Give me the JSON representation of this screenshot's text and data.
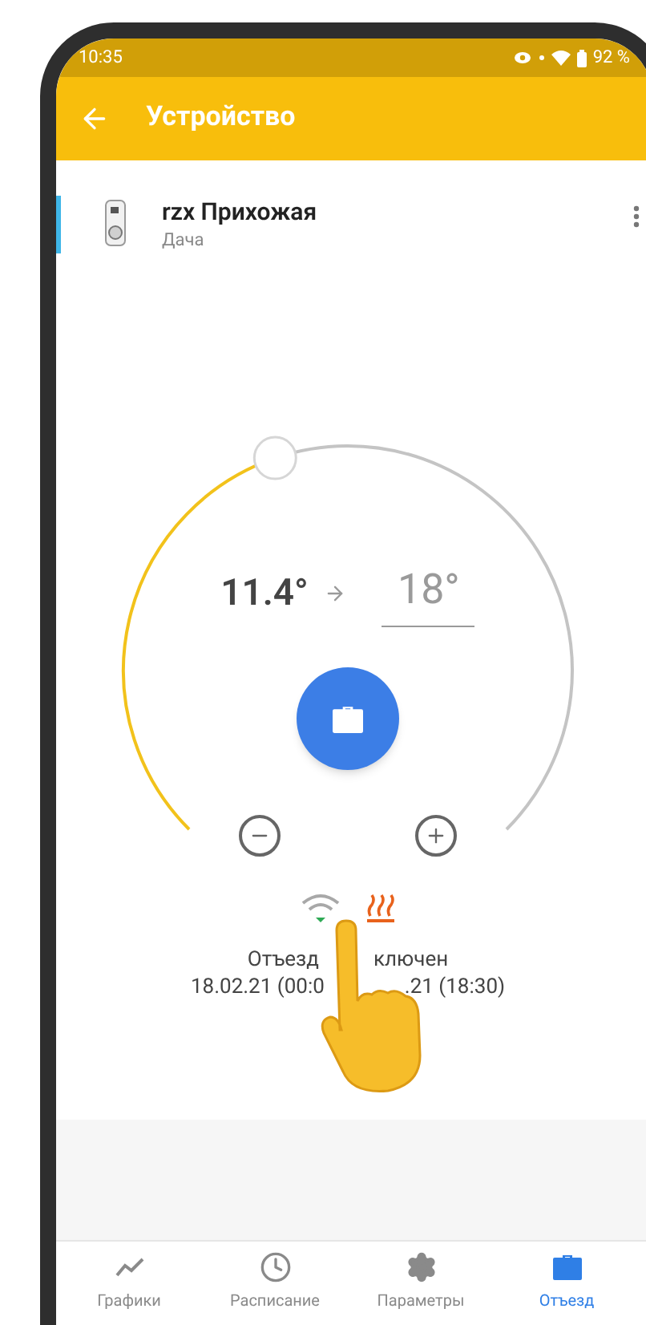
{
  "status_bar": {
    "time": "10:35",
    "battery": "92 %"
  },
  "app_bar": {
    "title": "Устройство"
  },
  "device": {
    "name": "rzx Прихожая",
    "location": "Дача"
  },
  "thermostat": {
    "current": "11.4°",
    "target": "18°"
  },
  "away_status": {
    "line_1_parts": [
      "Отъезд",
      "ключен"
    ],
    "line_2_parts": [
      "18.02.21 (00:0",
      ".21 (18:30)"
    ]
  },
  "tabs": [
    {
      "label": "Графики",
      "kind": "chart",
      "selected": false
    },
    {
      "label": "Расписание",
      "kind": "clock",
      "selected": false
    },
    {
      "label": "Параметры",
      "kind": "gear",
      "selected": false
    },
    {
      "label": "Отъезд",
      "kind": "briefcase",
      "selected": true
    }
  ]
}
